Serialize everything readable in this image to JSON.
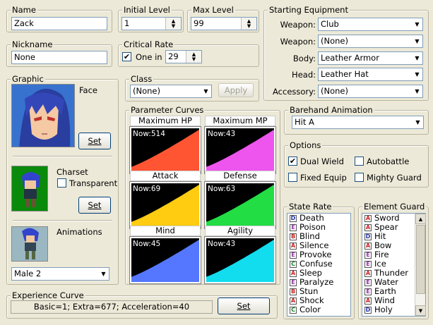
{
  "name": {
    "label": "Name",
    "value": "Zack"
  },
  "initial_level": {
    "label": "Initial Level",
    "value": "1"
  },
  "max_level": {
    "label": "Max Level",
    "value": "99"
  },
  "nickname": {
    "label": "Nickname",
    "value": "None"
  },
  "critical_rate": {
    "label": "Critical Rate",
    "checkbox_label": "One in",
    "value": "29",
    "checked": true
  },
  "starting_equipment": {
    "label": "Starting Equipment",
    "rows": [
      {
        "label": "Weapon:",
        "value": "Club"
      },
      {
        "label": "Weapon:",
        "value": "(None)"
      },
      {
        "label": "Body:",
        "value": "Leather Armor"
      },
      {
        "label": "Head:",
        "value": "Leather Hat"
      },
      {
        "label": "Accessory:",
        "value": "(None)"
      }
    ]
  },
  "graphic": {
    "label": "Graphic",
    "face_label": "Face",
    "charset_label": "Charset",
    "transparent_label": "Transparent",
    "animations_label": "Animations",
    "animation_value": "Male 2",
    "set_label": "Set"
  },
  "class": {
    "label": "Class",
    "value": "(None)",
    "apply_label": "Apply"
  },
  "parameter_curves": {
    "label": "Parameter Curves",
    "curves": [
      {
        "name": "Maximum HP",
        "now": "Now:514",
        "color": "#ff5533"
      },
      {
        "name": "Maximum MP",
        "now": "Now:43",
        "color": "#ee55ee"
      },
      {
        "name": "Attack",
        "now": "Now:69",
        "color": "#ffcc11"
      },
      {
        "name": "Defense",
        "now": "Now:63",
        "color": "#22dd44"
      },
      {
        "name": "Mind",
        "now": "Now:45",
        "color": "#5577ff"
      },
      {
        "name": "Agility",
        "now": "Now:43",
        "color": "#11ddee"
      }
    ]
  },
  "barehand": {
    "label": "Barehand Animation",
    "value": "Hit A"
  },
  "options": {
    "label": "Options",
    "dual_wield": "Dual Wield",
    "autobattle": "Autobattle",
    "fixed_equip": "Fixed Equip",
    "mighty_guard": "Mighty Guard",
    "dual_wield_checked": true
  },
  "state_rate": {
    "label": "State Rate",
    "items": [
      {
        "rank": "D",
        "name": "Death"
      },
      {
        "rank": "E",
        "name": "Poison"
      },
      {
        "rank": "B",
        "name": "Blind"
      },
      {
        "rank": "A",
        "name": "Silence"
      },
      {
        "rank": "E",
        "name": "Provoke"
      },
      {
        "rank": "C",
        "name": "Confuse"
      },
      {
        "rank": "A",
        "name": "Sleep"
      },
      {
        "rank": "E",
        "name": "Paralyze"
      },
      {
        "rank": "B",
        "name": "Stun"
      },
      {
        "rank": "A",
        "name": "Shock"
      },
      {
        "rank": "C",
        "name": "Color"
      }
    ]
  },
  "element_guard": {
    "label": "Element Guard",
    "items": [
      {
        "rank": "A",
        "name": "Sword"
      },
      {
        "rank": "A",
        "name": "Spear"
      },
      {
        "rank": "D",
        "name": "Hit"
      },
      {
        "rank": "A",
        "name": "Bow"
      },
      {
        "rank": "E",
        "name": "Fire"
      },
      {
        "rank": "E",
        "name": "Ice"
      },
      {
        "rank": "A",
        "name": "Thunder"
      },
      {
        "rank": "E",
        "name": "Water"
      },
      {
        "rank": "E",
        "name": "Earth"
      },
      {
        "rank": "A",
        "name": "Wind"
      },
      {
        "rank": "D",
        "name": "Holy"
      }
    ]
  },
  "experience_curve": {
    "label": "Experience Curve",
    "value": "Basic=1; Extra=677; Acceleration=40",
    "set_label": "Set"
  },
  "rank_colors": {
    "A": "#cc2222",
    "B": "#cc2222",
    "C": "#118822",
    "D": "#2233aa",
    "E": "#9933aa"
  }
}
